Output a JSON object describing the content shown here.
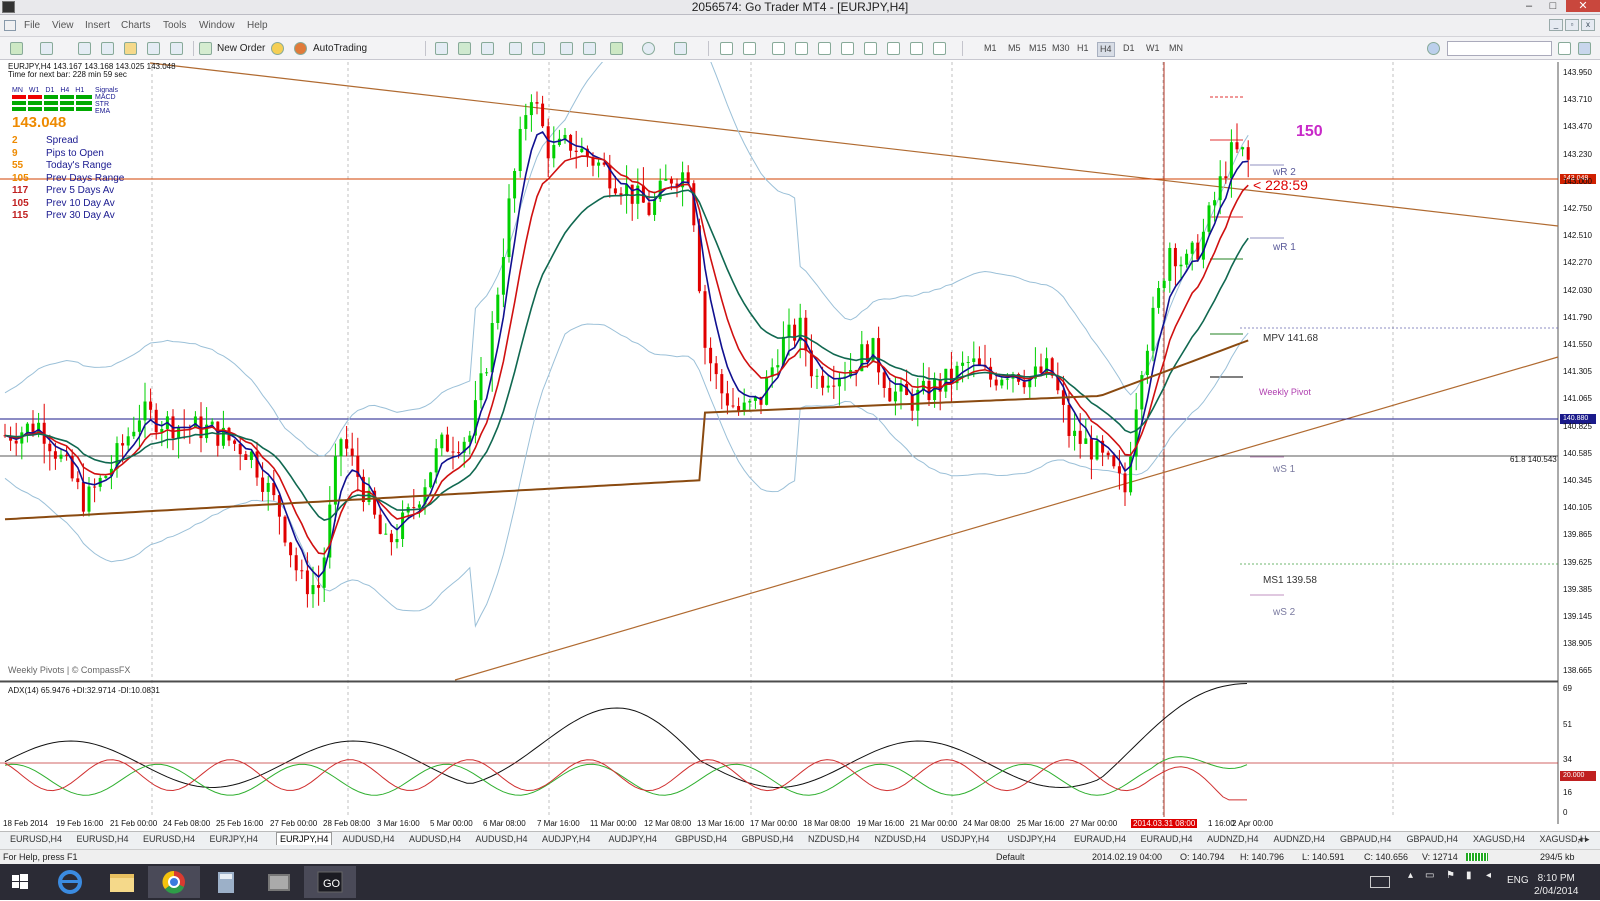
{
  "window": {
    "title": "2056574: Go Trader MT4 - [EURJPY,H4]"
  },
  "menu": [
    "File",
    "View",
    "Insert",
    "Charts",
    "Tools",
    "Window",
    "Help"
  ],
  "toolbar": {
    "new_order": "New Order",
    "autotrading": "AutoTrading",
    "timeframes": [
      "M1",
      "M5",
      "M15",
      "M30",
      "H1",
      "H4",
      "D1",
      "W1",
      "MN"
    ],
    "selected_tf": "H4",
    "search_placeholder": ""
  },
  "chart": {
    "info_line": "EURJPY,H4  143.167 143.168 143.025 143.048",
    "time_line": "Time for next bar: 228 min 59 sec",
    "signal_tfs": [
      "MN",
      "W1",
      "D1",
      "H4",
      "H1"
    ],
    "signal_names": [
      "Signals",
      "MACD",
      "STR",
      "EMA"
    ],
    "big_price": "143.048",
    "stats": [
      {
        "n": "2",
        "label": "Spread"
      },
      {
        "n": "9",
        "label": "Pips to Open"
      },
      {
        "n": "55",
        "label": "Today's Range"
      },
      {
        "n": "105",
        "label": "Prev Days Range"
      },
      {
        "n": "117",
        "label": "Prev 5 Days Av"
      },
      {
        "n": "105",
        "label": "Prev 10 Day Av"
      },
      {
        "n": "115",
        "label": "Prev 30 Day Av"
      }
    ],
    "pivots": {
      "wr2": "wR 2",
      "wr1": "wR 1",
      "mpv": "MPV  141.68",
      "weekly": "Weekly Pivot",
      "ws1": "wS 1",
      "ms1": "MS1  139.58",
      "ws2": "wS 2"
    },
    "annot_150": "150",
    "countdown": "228:59",
    "fib": "61.8  140.543",
    "copyright": "Weekly Pivots | © CompassFX",
    "adx_label": "ADX(14) 65.9476 +DI:32.9714 -DI:10.0831",
    "price_tag_current": "143.048",
    "price_tag_line": "140.880",
    "price_scale": [
      "143.950",
      "143.710",
      "143.470",
      "143.230",
      "143.000",
      "142.750",
      "142.510",
      "142.270",
      "142.030",
      "141.790",
      "141.550",
      "141.305",
      "141.065",
      "140.825",
      "140.585",
      "140.345",
      "140.105",
      "139.865",
      "139.625",
      "139.385",
      "139.145",
      "138.905",
      "138.665"
    ],
    "adx_scale": [
      "69",
      "51",
      "34",
      "20.000",
      "16",
      "0"
    ],
    "x_labels": [
      "18 Feb 2014",
      "19 Feb 16:00",
      "21 Feb 00:00",
      "24 Feb 08:00",
      "25 Feb 16:00",
      "27 Feb 00:00",
      "28 Feb 08:00",
      "3 Mar 16:00",
      "5 Mar 00:00",
      "6 Mar 08:00",
      "7 Mar 16:00",
      "11 Mar 00:00",
      "12 Mar 08:00",
      "13 Mar 16:00",
      "17 Mar 00:00",
      "18 Mar 08:00",
      "19 Mar 16:00",
      "21 Mar 00:00",
      "24 Mar 08:00",
      "25 Mar 16:00",
      "27 Mar 00:00",
      "2014.03.31 08:00",
      "1 16:00",
      "2 Apr 00:00"
    ],
    "x_highlight": "2014.03.31 08:00"
  },
  "tabs": [
    "EURUSD,H4",
    "EURUSD,H4",
    "EURUSD,H4",
    "EURJPY,H4",
    "EURJPY,H4",
    "AUDUSD,H4",
    "AUDUSD,H4",
    "AUDUSD,H4",
    "AUDJPY,H4",
    "AUDJPY,H4",
    "GBPUSD,H4",
    "GBPUSD,H4",
    "NZDUSD,H4",
    "NZDUSD,H4",
    "USDJPY,H4",
    "USDJPY,H4",
    "EURAUD,H4",
    "EURAUD,H4",
    "AUDNZD,H4",
    "AUDNZD,H4",
    "GBPAUD,H4",
    "GBPAUD,H4",
    "XAGUSD,H4",
    "XAGUSD,H"
  ],
  "selected_tab": 4,
  "status": {
    "help": "For Help, press F1",
    "profile": "Default",
    "datetime": "2014.02.19 04:00",
    "open": "O: 140.794",
    "high": "H: 140.796",
    "low": "L: 140.591",
    "close": "C: 140.656",
    "volume": "V: 12714",
    "traffic": "294/5 kb"
  },
  "taskbar": {
    "lang": "ENG",
    "time": "8:10 PM",
    "date": "2/04/2014"
  },
  "colors": {
    "bull": "#00d000",
    "bear": "#e00000",
    "ema_fast": "#101090",
    "ema_slow": "#d01010",
    "ema_mid": "#106850",
    "ema200": "#8a4a10",
    "bb": "#9bc0d8",
    "trend": "#b06a30"
  }
}
